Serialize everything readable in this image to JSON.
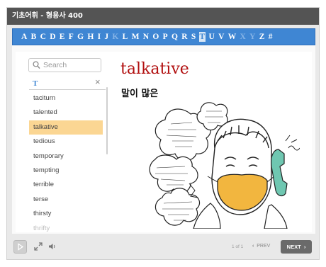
{
  "window": {
    "title": "기초어휘 - 형용사 400"
  },
  "alphabet": {
    "letters": [
      {
        "l": "A",
        "s": "normal"
      },
      {
        "l": "B",
        "s": "normal"
      },
      {
        "l": "C",
        "s": "normal"
      },
      {
        "l": "D",
        "s": "normal"
      },
      {
        "l": "E",
        "s": "normal"
      },
      {
        "l": "F",
        "s": "normal"
      },
      {
        "l": "G",
        "s": "normal"
      },
      {
        "l": "H",
        "s": "normal"
      },
      {
        "l": "I",
        "s": "normal"
      },
      {
        "l": "J",
        "s": "normal"
      },
      {
        "l": "K",
        "s": "dim"
      },
      {
        "l": "L",
        "s": "normal"
      },
      {
        "l": "M",
        "s": "normal"
      },
      {
        "l": "N",
        "s": "normal"
      },
      {
        "l": "O",
        "s": "normal"
      },
      {
        "l": "P",
        "s": "normal"
      },
      {
        "l": "Q",
        "s": "normal"
      },
      {
        "l": "R",
        "s": "normal"
      },
      {
        "l": "S",
        "s": "normal"
      },
      {
        "l": "T",
        "s": "active"
      },
      {
        "l": "U",
        "s": "normal"
      },
      {
        "l": "V",
        "s": "normal"
      },
      {
        "l": "W",
        "s": "normal"
      },
      {
        "l": "X",
        "s": "dim"
      },
      {
        "l": "Y",
        "s": "dim"
      },
      {
        "l": "Z",
        "s": "normal"
      },
      {
        "l": "#",
        "s": "normal"
      }
    ]
  },
  "sidebar": {
    "search_placeholder": "Search",
    "filter_label": "T",
    "clear_symbol": "×",
    "words": [
      "taciturn",
      "talented",
      "talkative",
      "tedious",
      "temporary",
      "tempting",
      "terrible",
      "terse",
      "thirsty",
      "thrifty"
    ],
    "selected_index": 2
  },
  "content": {
    "word": "talkative",
    "meaning": "말이 많은"
  },
  "controls": {
    "page_counter": "1 of 1",
    "prev_label": "PREV",
    "next_label": "NEXT"
  },
  "colors": {
    "accent": "#3f86d3",
    "title_bar": "#545454",
    "word_color": "#b10f0f",
    "selected_bg": "#fbd693"
  },
  "icons": [
    "search-icon",
    "close-icon",
    "play-icon",
    "fullscreen-icon",
    "volume-icon",
    "chevron-left-icon",
    "chevron-right-icon"
  ]
}
